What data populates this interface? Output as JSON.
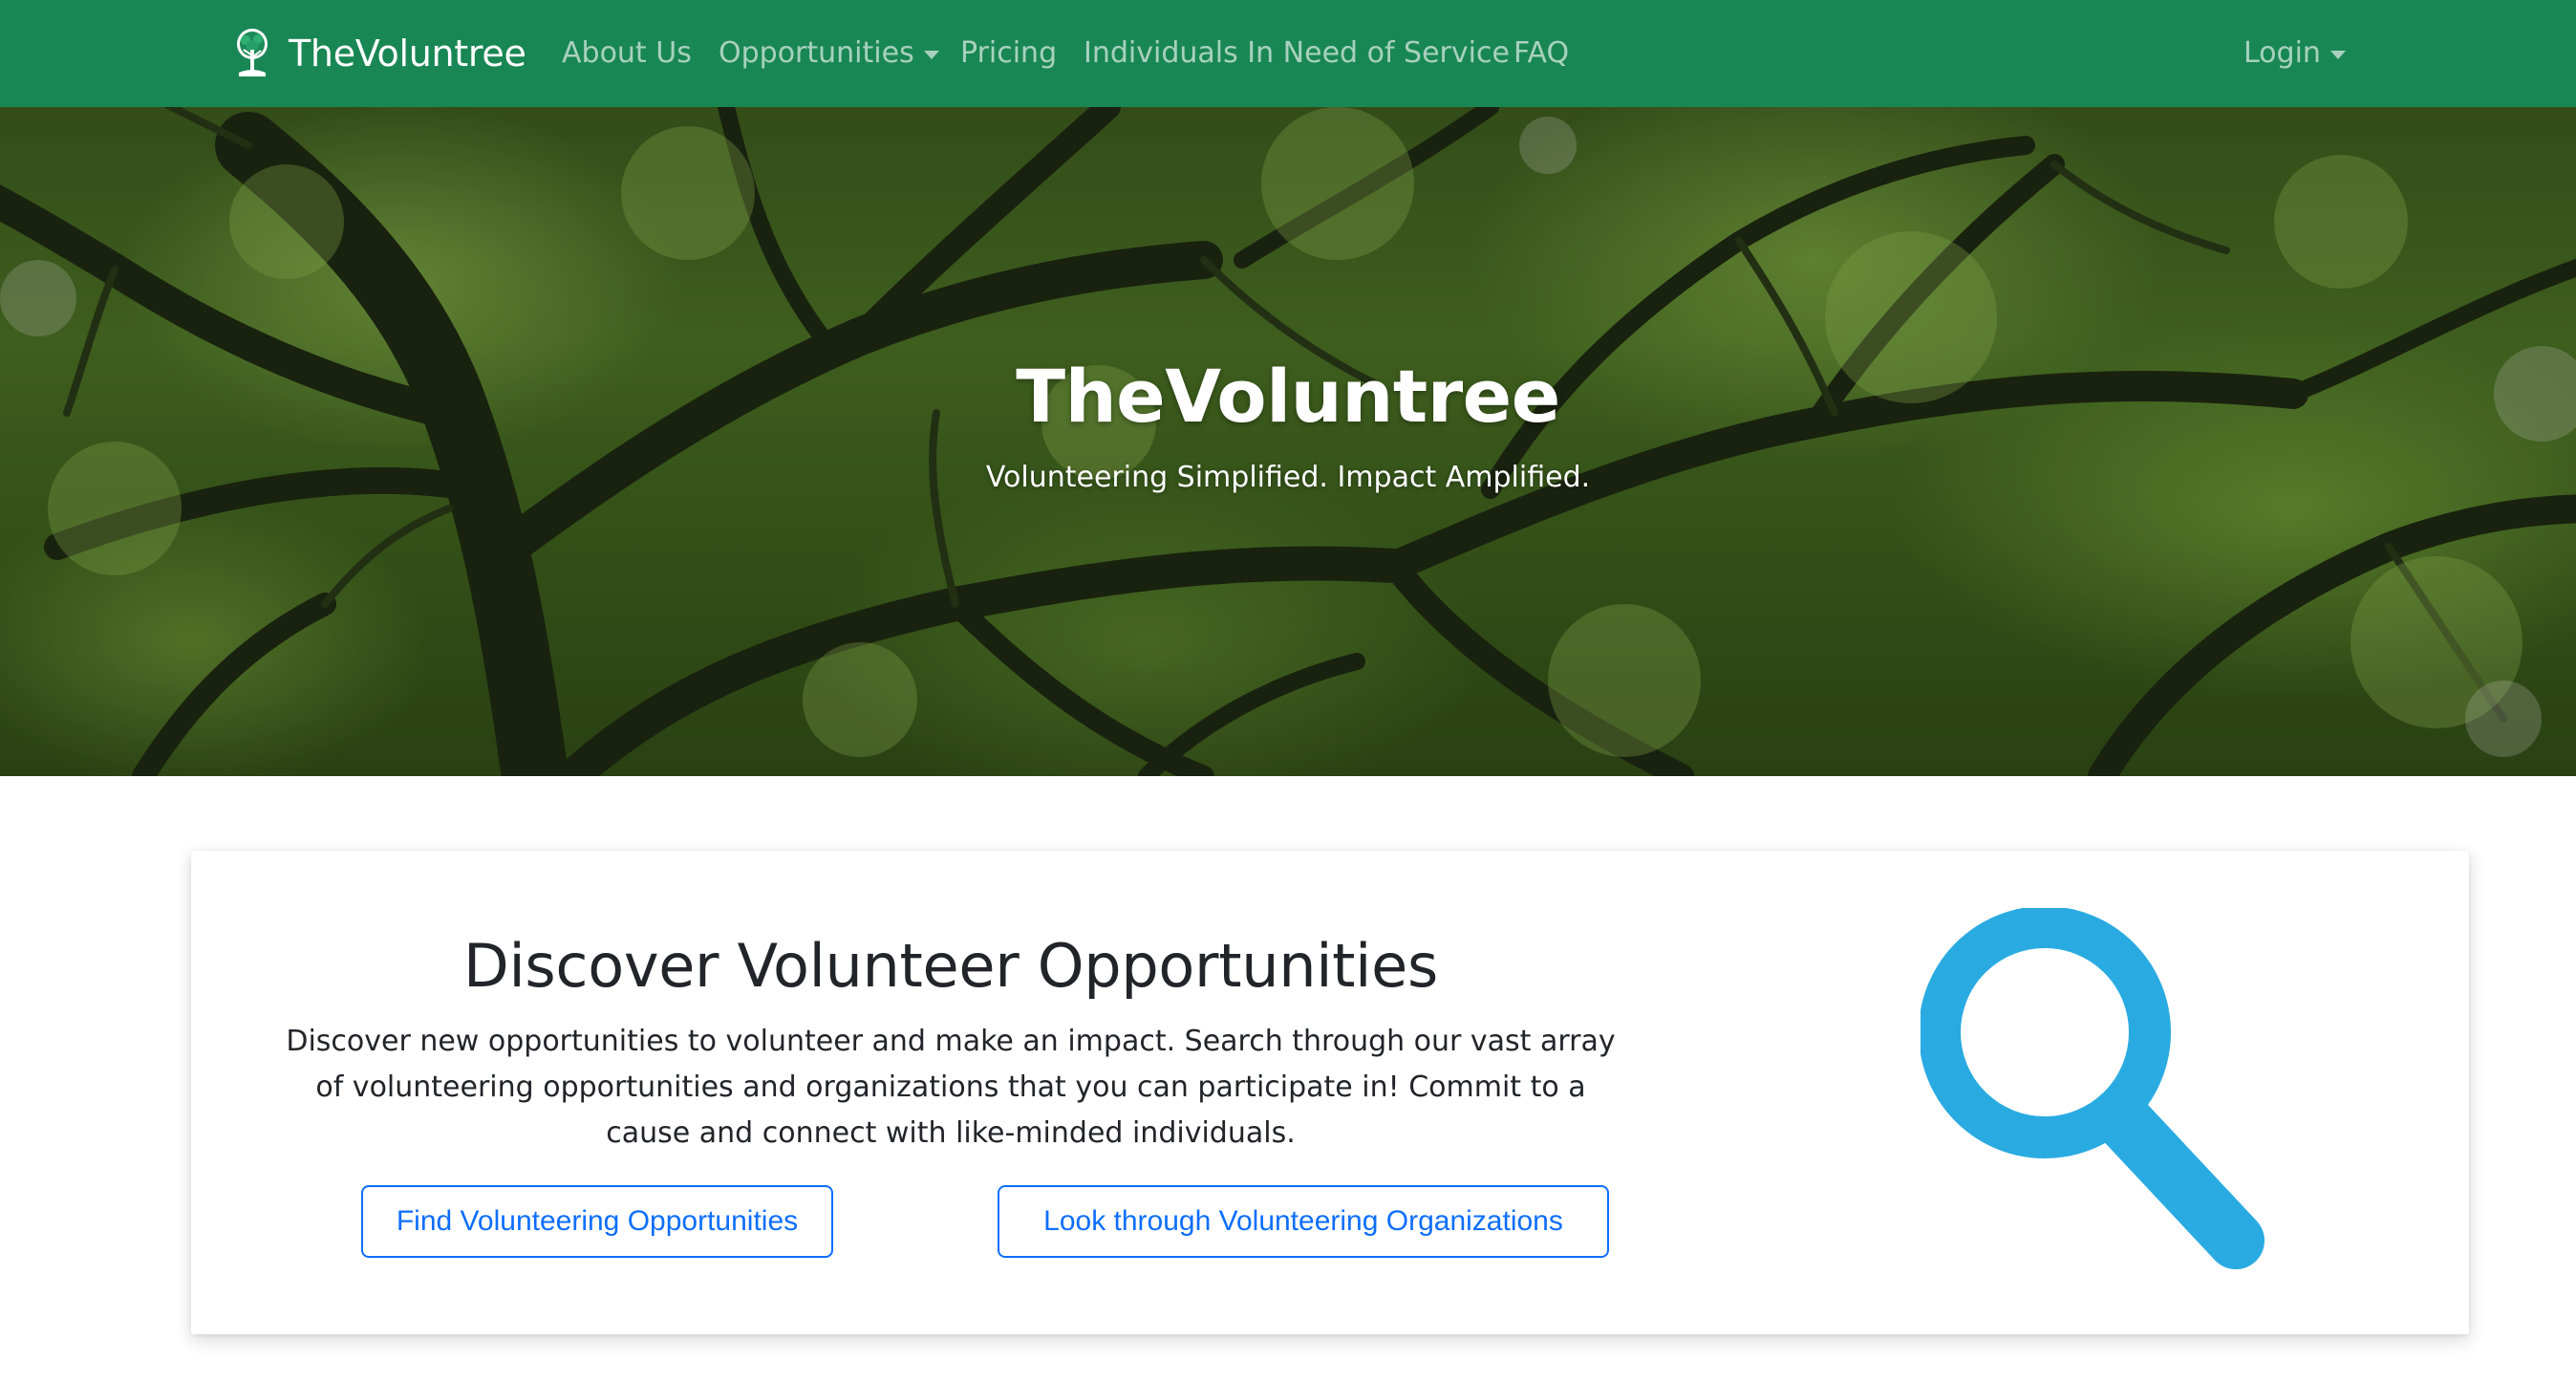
{
  "navbar": {
    "brand": "TheVoluntree",
    "links": [
      {
        "label": "About Us"
      },
      {
        "label": "Opportunities"
      },
      {
        "label": "Pricing"
      },
      {
        "label": "Individuals In Need of Service"
      },
      {
        "label": "FAQ"
      }
    ],
    "login_label": "Login",
    "background_color": "#198754"
  },
  "hero": {
    "title": "TheVoluntree",
    "subtitle": "Volunteering Simplified. Impact Amplified."
  },
  "discover_card": {
    "title": "Discover Volunteer Opportunities",
    "description": "Discover new opportunities to volunteer and make an impact. Search through our vast array of volunteering opportunities and organizations that you can participate in! Commit to a cause and connect with like-minded individuals.",
    "find_button_label": "Find Volunteering Opportunities",
    "orgs_button_label": "Look through Volunteering Organizations",
    "button_color": "#0d6efd",
    "icon": "magnifying-glass-icon",
    "icon_color": "#29abe2"
  }
}
